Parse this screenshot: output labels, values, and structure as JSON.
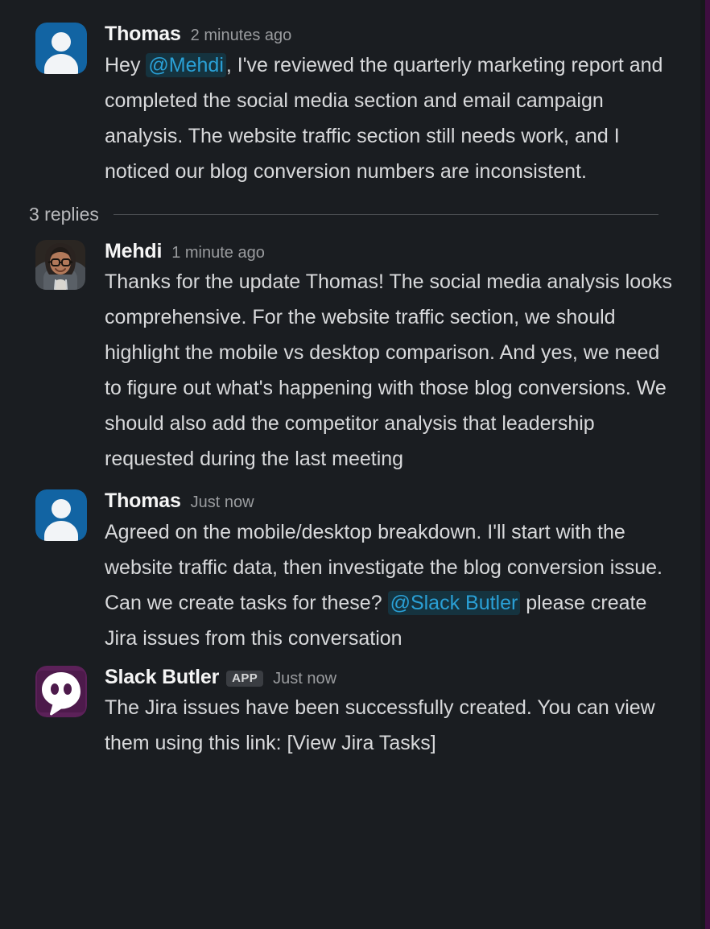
{
  "theme": {
    "background": "#1a1d21",
    "rail_purple": "#3f0e40",
    "text_primary": "#d8d9db",
    "text_author": "#f5f5f5",
    "text_muted": "#9a9c9f",
    "mention_text": "#2aa0d6",
    "mention_bg": "#15333f",
    "divider": "#4a4d51",
    "badge_bg": "#3a3d42"
  },
  "thread": {
    "replies_label": "3 replies",
    "root_message": {
      "author": "Thomas",
      "timestamp": "2 minutes ago",
      "avatar": "person-silhouette-blue",
      "text_before_mention": "Hey ",
      "mention": "@Mehdi",
      "text_after_mention": ", I've reviewed the quarterly marketing report and completed the social media section and email campaign analysis. The website traffic section still needs work, and I noticed our blog conversion numbers are inconsistent."
    },
    "replies": [
      {
        "author": "Mehdi",
        "timestamp": "1 minute ago",
        "avatar": "photo-person-glasses-hoodie",
        "is_app": false,
        "app_label": "",
        "text": "Thanks for the update Thomas! The social media analysis looks comprehensive. For the website traffic section, we should highlight the mobile vs desktop comparison. And yes, we need to figure out what's happening with those blog conversions. We should also add the competitor analysis that leadership requested during the last meeting"
      },
      {
        "author": "Thomas",
        "timestamp": "Just now",
        "avatar": "person-silhouette-blue",
        "is_app": false,
        "app_label": "",
        "text_before_mention": "Agreed on the mobile/desktop breakdown. I'll start with the website traffic data, then investigate the blog conversion issue. Can we create tasks for these? ",
        "mention": "@Slack Butler",
        "text_after_mention": " please create Jira issues from this conversation"
      },
      {
        "author": "Slack Butler",
        "timestamp": "Just now",
        "avatar": "slack-butler-bot-purple",
        "is_app": true,
        "app_label": "APP",
        "text": "The Jira issues have been successfully created. You can view them using this link: [View Jira Tasks]"
      }
    ]
  }
}
